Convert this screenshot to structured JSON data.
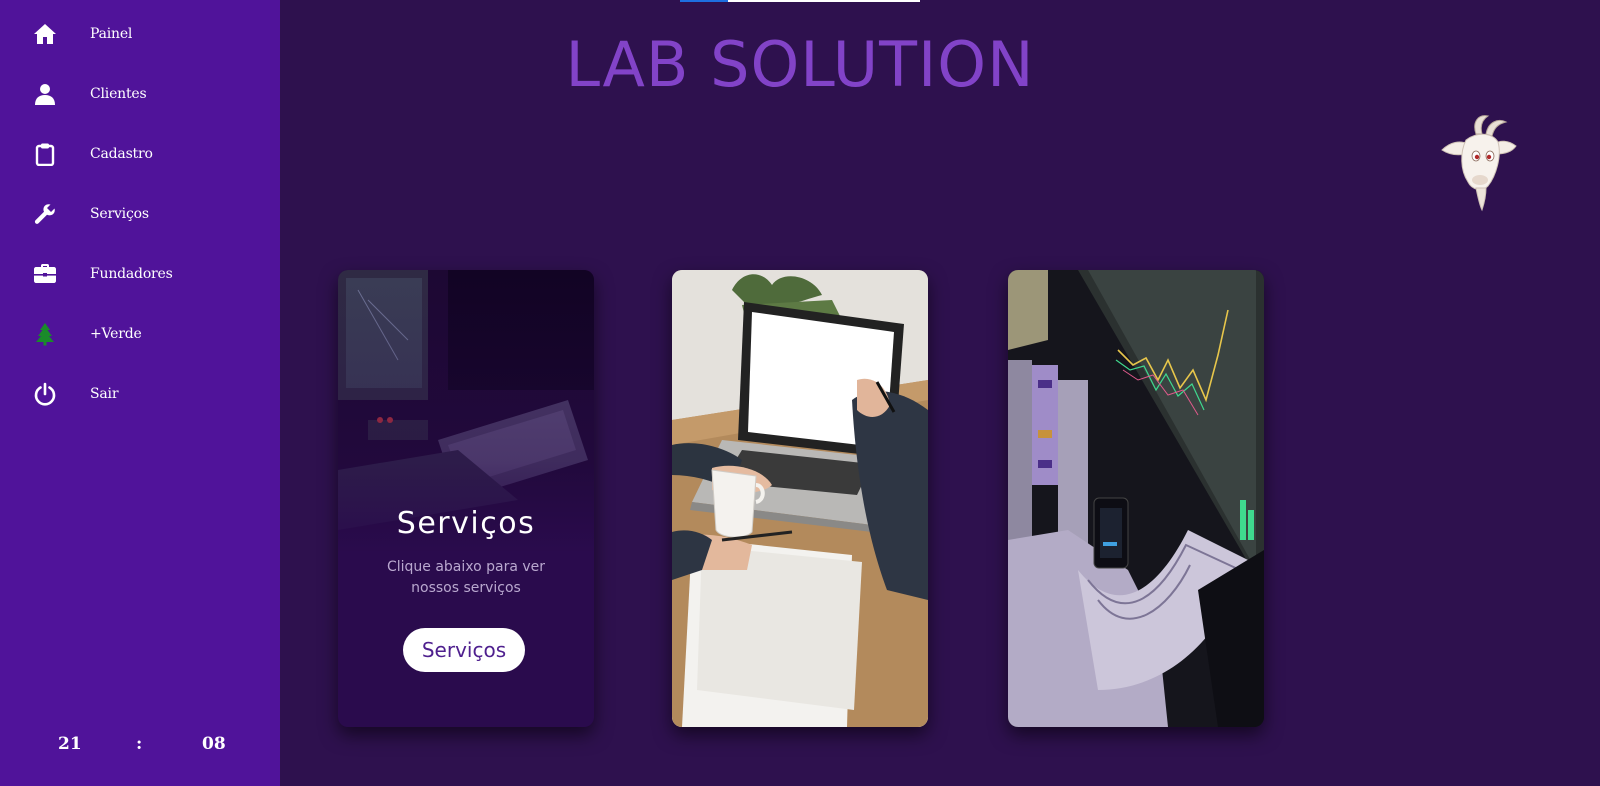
{
  "brand": {
    "title": "LAB SOLUTION",
    "title_color": "#8243c8",
    "mascot": "goat-mascot"
  },
  "sidebar": {
    "background": "#50139a",
    "items": [
      {
        "label": "Painel",
        "icon": "home-icon"
      },
      {
        "label": "Clientes",
        "icon": "user-icon"
      },
      {
        "label": "Cadastro",
        "icon": "clipboard-icon"
      },
      {
        "label": "Serviços",
        "icon": "wrench-icon"
      },
      {
        "label": "Fundadores",
        "icon": "briefcase-icon"
      },
      {
        "label": "+Verde",
        "icon": "tree-icon",
        "icon_color": "#1a8a2a"
      },
      {
        "label": "Sair",
        "icon": "power-icon"
      }
    ],
    "clock": {
      "hours": "21",
      "separator": ":",
      "minutes": "08"
    }
  },
  "cards": [
    {
      "title": "Serviços",
      "text": "Clique abaixo para ver nossos serviços",
      "button_label": "Serviços",
      "image": "computer-desk-photo"
    },
    {
      "image": "laptop-meeting-photo"
    },
    {
      "image": "money-stock-chart-photo"
    }
  ],
  "colors": {
    "page_background": "#2e114e",
    "button_text": "#4e1f8e"
  }
}
